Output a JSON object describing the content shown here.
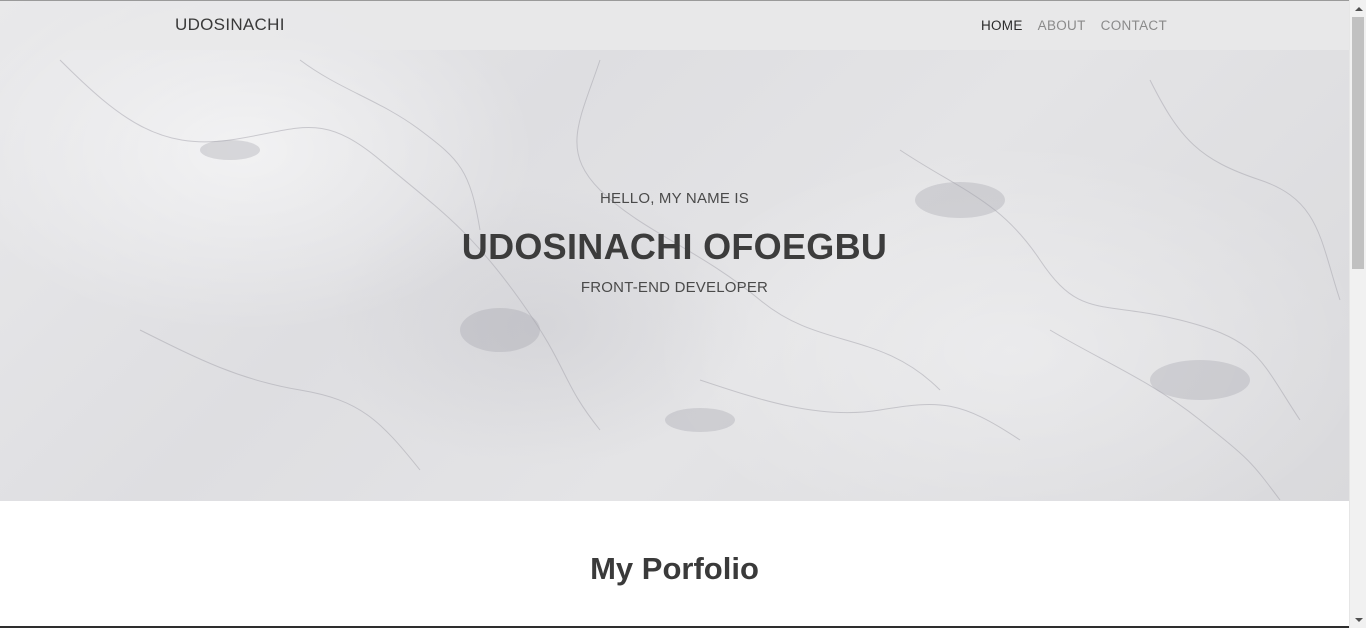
{
  "navbar": {
    "brand": "UDOSINACHI",
    "links": [
      {
        "label": "HOME",
        "active": true
      },
      {
        "label": "ABOUT",
        "active": false
      },
      {
        "label": "CONTACT",
        "active": false
      }
    ]
  },
  "hero": {
    "greeting": "HELLO, MY NAME IS",
    "name": "UDOSINACHI OFOEGBU",
    "role": "FRONT-END DEVELOPER"
  },
  "portfolio": {
    "title": "My Porfolio"
  },
  "scrollbar": {
    "up_icon": "chevron-up-icon",
    "down_icon": "chevron-down-icon"
  },
  "colors": {
    "nav_background": "#e8e8e9",
    "text_dark": "#3a3a3a",
    "nav_inactive": "#8a8a8a"
  }
}
